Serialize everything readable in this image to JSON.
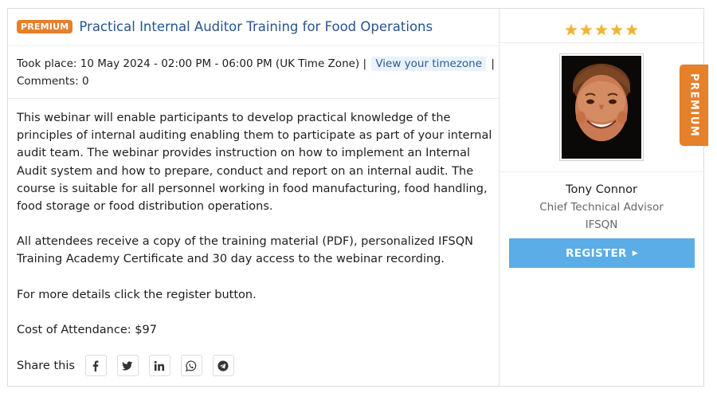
{
  "event": {
    "badge": "PREMIUM",
    "title": "Practical Internal Auditor Training for Food Operations",
    "took_place_label": "Took place: 10 May 2024 - 02:00 PM - 06:00 PM (UK Time Zone) |",
    "timezone_button": "View your timezone",
    "separator": "|",
    "comments": "Comments: 0",
    "description": [
      "This webinar will enable participants to develop practical knowledge of the principles of internal auditing enabling them to participate as part of your internal audit team. The webinar provides instruction on how to implement an Internal Audit system and how to prepare, conduct and report on an internal audit. The course is suitable for all personnel working in food manufacturing, food handling, food storage or food distribution operations.",
      "All attendees receive a copy of the training material (PDF), personalized IFSQN Training Academy Certificate and 30 day access to the webinar recording.",
      "For more details click the register button.",
      "Cost of Attendance: $97"
    ],
    "share_label": "Share this",
    "share_icons": [
      "facebook-icon",
      "twitter-icon",
      "linkedin-icon",
      "whatsapp-icon",
      "telegram-icon"
    ]
  },
  "sidebar": {
    "rating": 5,
    "star_glyph": "★",
    "presenter_name": "Tony Connor",
    "presenter_role": "Chief Technical Advisor",
    "presenter_org": "IFSQN",
    "register_label": "REGISTER",
    "register_caret": "▶"
  },
  "premium_tab": "PREMIUM",
  "colors": {
    "accent_orange": "#e5802b",
    "title_blue": "#27548e",
    "register_blue": "#5aade6",
    "star_gold": "#f0b52d"
  }
}
